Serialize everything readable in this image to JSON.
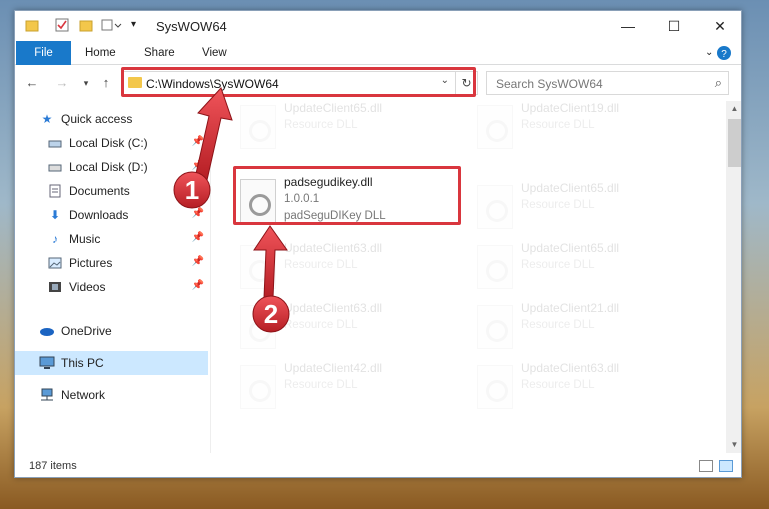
{
  "window": {
    "title": "SysWOW64"
  },
  "ribbon": {
    "tabs": [
      "File",
      "Home",
      "Share",
      "View"
    ]
  },
  "address": {
    "path": "C:\\Windows\\SysWOW64"
  },
  "search": {
    "placeholder": "Search SysWOW64"
  },
  "sidebar": {
    "items": [
      {
        "label": "Quick access",
        "icon": "star-icon"
      },
      {
        "label": "Local Disk (C:)",
        "icon": "drive-icon"
      },
      {
        "label": "Local Disk (D:)",
        "icon": "drive-icon"
      },
      {
        "label": "Documents",
        "icon": "documents-icon"
      },
      {
        "label": "Downloads",
        "icon": "download-icon"
      },
      {
        "label": "Music",
        "icon": "music-icon"
      },
      {
        "label": "Pictures",
        "icon": "pictures-icon"
      },
      {
        "label": "Videos",
        "icon": "videos-icon"
      },
      {
        "label": "OneDrive",
        "icon": "cloud-icon"
      },
      {
        "label": "This PC",
        "icon": "computer-icon"
      },
      {
        "label": "Network",
        "icon": "network-icon"
      }
    ]
  },
  "files": {
    "highlighted": {
      "name": "padsegudikey.dll",
      "version": "1.0.0.1",
      "description": "padSeguDIKey DLL"
    },
    "left_column": [
      {
        "name": "UpdateClient65.dll",
        "type": "Resource DLL"
      },
      {
        "name": "UpdateClient63.dll",
        "type": "Resource DLL"
      },
      {
        "name": "UpdateClient63.dll",
        "type": "Resource DLL"
      },
      {
        "name": "UpdateClient42.dll",
        "type": "Resource DLL"
      }
    ],
    "right_column": [
      {
        "name": "UpdateClient19.dll",
        "type": "Resource DLL"
      },
      {
        "name": "UpdateClient65.dll",
        "type": "Resource DLL"
      },
      {
        "name": "UpdateClient65.dll",
        "type": "Resource DLL"
      },
      {
        "name": "UpdateClient21.dll",
        "type": "Resource DLL"
      },
      {
        "name": "UpdateClient63.dll",
        "type": "Resource DLL"
      }
    ]
  },
  "status": {
    "item_count": "187 items"
  },
  "annotations": {
    "step1": "1",
    "step2": "2"
  },
  "colors": {
    "accent": "#1979ca",
    "highlight_red": "#d9363e",
    "selected_bg": "#cce8ff"
  }
}
